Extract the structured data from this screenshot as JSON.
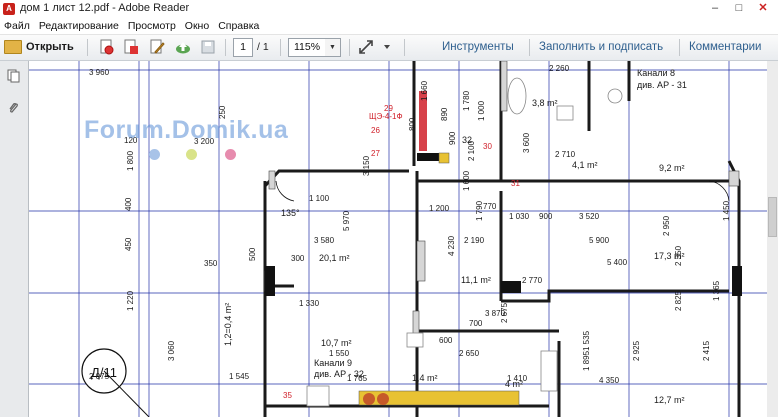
{
  "window": {
    "title": "дом 1 лист 12.pdf - Adobe Reader",
    "minimize": "–",
    "maximize": "□",
    "close": "✕"
  },
  "menu": [
    "Файл",
    "Редактирование",
    "Просмотр",
    "Окно",
    "Справка"
  ],
  "toolbar": {
    "open_label": "Открыть",
    "page_current": "1",
    "page_total": "/ 1",
    "zoom": "115%",
    "zoom_arrow": "▼",
    "tools_label": "Инструменты",
    "fill_sign_label": "Заполнить и подписать",
    "comments_label": "Комментарии",
    "more_arrow": "▾"
  },
  "watermark": "Forum.Domik.ua",
  "colors": {
    "accent": "#2e5f8e",
    "plan_blue": "#2230a8",
    "red_annotation": "#d0202a",
    "dot1": "#a8c3e8",
    "dot2": "#d9e389",
    "dot3": "#e78cae"
  },
  "plan": {
    "rooms": [
      {
        "label": "3,8 m²"
      },
      {
        "label": "4,1 m²"
      },
      {
        "label": "9,2 m²"
      },
      {
        "label": "20,1 m²"
      },
      {
        "label": "11,1 m²"
      },
      {
        "label": "17,3 m²"
      },
      {
        "label": "10,7 m²"
      },
      {
        "label": "4 m²"
      },
      {
        "label": "12,7 m²"
      },
      {
        "label": "1,4 m²"
      },
      {
        "label": "1,2=0,4 m²"
      }
    ],
    "notes": [
      "Канали 8",
      "див. AP - 31",
      "Канали 9",
      "див. AP - 32",
      "Д/11",
      "135°",
      "29",
      "ЩЭ-4-1Ф",
      "26",
      "27",
      "30",
      "31",
      "32",
      "35"
    ],
    "dims": [
      "3 960",
      "3 200",
      "3 580",
      "1 330",
      "3 520",
      "5 900",
      "5 400",
      "2 190",
      "1 030",
      "900",
      "3 870",
      "2 650",
      "4 350",
      "1 410",
      "2 260",
      "2 710",
      "1 800",
      "3 150",
      "5 970",
      "4 230",
      "2 950",
      "1 220",
      "3 060",
      "2 075",
      "1 895",
      "2 925",
      "1 660",
      "1 780",
      "1 600",
      "120",
      "250",
      "300",
      "350",
      "400",
      "450",
      "500",
      "600",
      "700",
      "770",
      "800",
      "890",
      "900",
      "1 000",
      "1 100",
      "1 200",
      "1 450",
      "1 545",
      "1 550",
      "1 765",
      "1 790",
      "2 100",
      "3 600",
      "2 770",
      "2 675",
      "2 825",
      "2 415",
      "1 365",
      "1 535",
      "2 350"
    ]
  }
}
